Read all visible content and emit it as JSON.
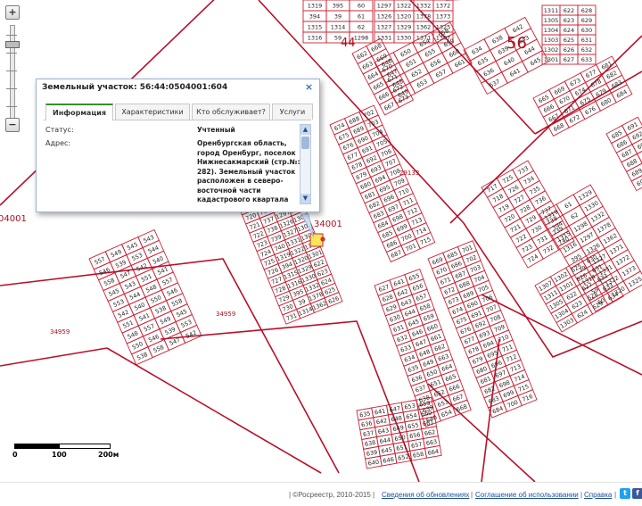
{
  "map": {
    "quarter_numbers": [
      "44",
      "56"
    ],
    "cadastral_labels": [
      "04001",
      "34001",
      "34959",
      "34959",
      "29133"
    ],
    "parcel_numbers": [
      "1319",
      "394",
      "1315",
      "1316",
      "395",
      "39",
      "1314",
      "59",
      "60",
      "61",
      "62",
      "1298",
      "1297",
      "1326",
      "1327",
      "1331",
      "1322",
      "1320",
      "1329",
      "1330",
      "1332",
      "1378",
      "1362",
      "1371",
      "1372",
      "1373",
      "1325",
      "1307",
      "1311",
      "1305",
      "1304",
      "1303",
      "1302",
      "1301",
      "622",
      "623",
      "624",
      "625",
      "626",
      "627",
      "628",
      "629",
      "630",
      "631",
      "632",
      "633",
      "634",
      "635",
      "636",
      "637",
      "638",
      "639",
      "640",
      "641",
      "642",
      "643",
      "644",
      "645",
      "646",
      "647",
      "648",
      "649",
      "650",
      "651",
      "652",
      "653",
      "654",
      "655",
      "656",
      "657",
      "658",
      "659",
      "660",
      "661",
      "662",
      "663",
      "664",
      "665",
      "666",
      "667",
      "668",
      "669",
      "670",
      "671",
      "672",
      "673",
      "674",
      "675",
      "676",
      "677",
      "678",
      "679",
      "680",
      "681",
      "682",
      "683",
      "684",
      "685",
      "686",
      "687",
      "688",
      "689",
      "690",
      "691",
      "692",
      "693",
      "694",
      "695",
      "696",
      "697",
      "698",
      "699",
      "700",
      "701",
      "702",
      "703",
      "704",
      "705",
      "706",
      "707",
      "708",
      "709",
      "710",
      "711",
      "712",
      "713",
      "714",
      "715",
      "716",
      "717",
      "718",
      "719",
      "720",
      "721",
      "722",
      "723",
      "724",
      "725",
      "726",
      "727",
      "728",
      "729",
      "730",
      "731",
      "732",
      "733",
      "734",
      "735",
      "736",
      "737",
      "738",
      "739",
      "740"
    ],
    "parcel_numbers_left": [
      "557",
      "546",
      "558",
      "545",
      "553",
      "542",
      "551",
      "548",
      "550",
      "538",
      "549",
      "539",
      "547",
      "543",
      "544",
      "540",
      "541"
    ]
  },
  "popup": {
    "title": "Земельный участок: 56:44:0504001:604",
    "tabs": [
      {
        "label": "Информация",
        "active": true
      },
      {
        "label": "Характеристики",
        "active": false
      },
      {
        "label": "Кто обслуживает?",
        "active": false
      },
      {
        "label": "Услуги",
        "active": false
      }
    ],
    "status_label": "Статус:",
    "status_value": "Учтенный",
    "address_label": "Адрес:",
    "address_value_lines": [
      "Оренбургская область,",
      "город Оренбург, поселок",
      "Нижнесакмарский (стр.№:",
      "282). Земельный участок",
      "расположен в северо-",
      "восточной части",
      "кадастрового квартала"
    ]
  },
  "scale": {
    "labels": [
      "0",
      "100",
      "200м"
    ]
  },
  "footer": {
    "copyright": "| ©Росреестр, 2010-2015 |",
    "link_updates": "Сведения об обновлениях",
    "sep1": "|",
    "link_terms": "Соглашение об использовании",
    "sep2": "|",
    "link_help": "Справка",
    "sep3": "|"
  },
  "colors": {
    "parcel_line": "#cc2233",
    "label_text": "#aa1122",
    "highlight_parcel": "#f7e85a",
    "tab_active_border": "#3a8d2f"
  }
}
